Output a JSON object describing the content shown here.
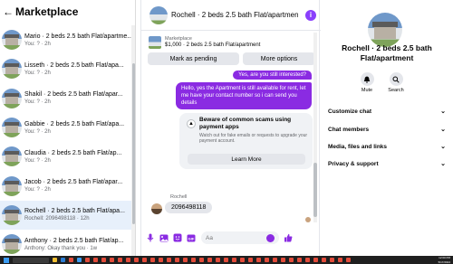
{
  "sidebar": {
    "title": "Marketplace",
    "conversations": [
      {
        "name": "Mario · 2 beds 2.5 bath Flat/apartme...",
        "sub": "You: ? · 2h"
      },
      {
        "name": "Lisseth · 2 beds 2.5 bath Flat/apa...",
        "sub": "You: ? · 2h"
      },
      {
        "name": "Shakil · 2 beds 2.5 bath Flat/apar...",
        "sub": "You: ? · 2h"
      },
      {
        "name": "Gabbie · 2 beds 2.5 bath Flat/apa...",
        "sub": "You: ? · 2h"
      },
      {
        "name": "Claudia · 2 beds 2.5 bath Flat/ap...",
        "sub": "You: ? · 2h"
      },
      {
        "name": "Jacob · 2 beds 2.5 bath Flat/apar...",
        "sub": "You: ? · 2h"
      },
      {
        "name": "Rochell · 2 beds 2.5 bath Flat/apa...",
        "sub": "Rochell: 2096498118 · 12h",
        "active": true
      },
      {
        "name": "Anthony · 2 beds 2.5 bath Flat/ap...",
        "sub": "Anthony: Okay thank you · 1w"
      }
    ]
  },
  "chat": {
    "header_title": "Rochell · 2 beds 2.5 bath Flat/apartmen...",
    "listing_label": "Marketplace",
    "listing_price": "$1,000 · 2 beds 2.5 bath Flat/apartment",
    "mark_pending_label": "Mark as pending",
    "more_options_label": "More options",
    "msg_out_1": "Yes, are you still interested?",
    "msg_out_2": "Hello, yes the Apartment is still available for rent, let me have your contact number so i can send you details",
    "scam_title": "Beware of common scams using payment apps",
    "scam_body": "Watch out for fake emails or requests to upgrade your payment account.",
    "learn_more_label": "Learn More",
    "sender_name": "Rochell",
    "msg_in": "2096498118",
    "composer_placeholder": "Aa"
  },
  "info_panel": {
    "name": "Rochell · 2 beds 2.5 bath Flat/apartment",
    "mute_label": "Mute",
    "search_label": "Search",
    "sections": [
      "Customize chat",
      "Chat members",
      "Media, files and links",
      "Privacy & support"
    ]
  },
  "taskbar": {
    "time": "12:00 PM",
    "date": "5/17/2024"
  },
  "colors": {
    "accent": "#8a2be2",
    "bubble_in": "#e4e6eb"
  }
}
